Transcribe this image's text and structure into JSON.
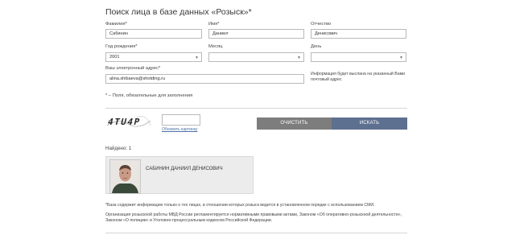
{
  "form": {
    "title": "Поиск лица в базе данных «Розыск»*",
    "surname_label": "Фамилия*",
    "surname_value": "Сабинин",
    "name_label": "Имя*",
    "name_value": "Даниил",
    "patronymic_label": "Отчество",
    "patronymic_value": "Денисович",
    "year_label": "Год рождения*",
    "year_value": "2001",
    "month_label": "Месяц",
    "month_value": "",
    "day_label": "День",
    "day_value": "",
    "email_label": "Ваш электронный адрес*",
    "email_value": "alina.shibaeva@shotding.ru",
    "email_note": "Информация будет выслана на указанный Вами почтовый адрес",
    "required_note": "* – Поля, обязательные для заполнения"
  },
  "captcha": {
    "image_text": "4TU4P",
    "input_value": "",
    "refresh_label": "Обновить картинку"
  },
  "buttons": {
    "clear_label": "ОЧИСТИТЬ",
    "search_label": "ИСКАТЬ"
  },
  "results": {
    "found_label": "Найдено: 1",
    "items": [
      {
        "name": "САБИНИН ДАНИИЛ ДЕНИСОВИЧ"
      }
    ]
  },
  "footer": {
    "disclaimer": "*База содержит информацию только о тех лицах, в отношении которых розыск ведется в установленном порядке с использованием СМИ.",
    "law_text": "Организация розыскной работы МВД России регламентируется нормативными правовыми актами, Законом «Об оперативно-розыскной деятельности», Законом «О полиции» и Уголовно-процессуальным кодексом Российской Федерации."
  },
  "colors": {
    "clear_button": "#7d7d7d",
    "search_button": "#5e7090",
    "link": "#4a6fa8"
  }
}
